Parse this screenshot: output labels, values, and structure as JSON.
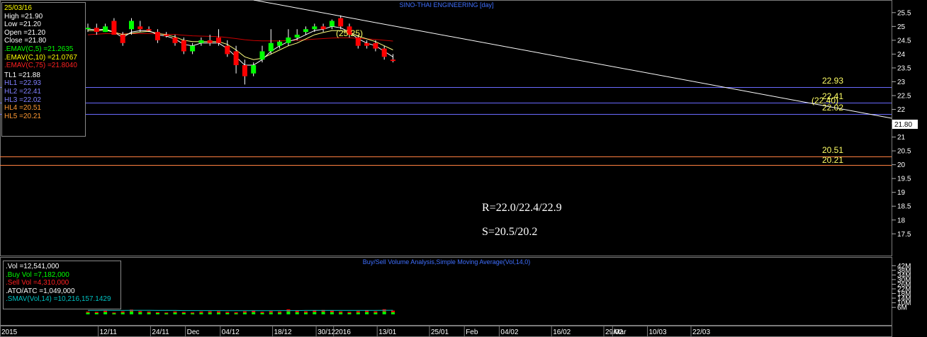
{
  "header": {
    "title": "SINO-THAI ENGINEERING [day]",
    "volume_title": "Buy/Sell Volume Analysis,Simple Moving Average(Vol,14,0)"
  },
  "info_panel": {
    "date": "25/03/16",
    "high": "High  =21.90",
    "low": "Low   =21.20",
    "open": "Open  =21.20",
    "close": "Close  =21.80",
    "emav5": ".EMAV(C,5)   =21.2635",
    "emav10": ".EMAV(C,10)  =21.0767",
    "emav75": ".EMAV(C,75)  =21.8040",
    "tl1": "TL1 =21.88",
    "hl1": "HL1 =22.93",
    "hl2": "HL2 =22.41",
    "hl3": "HL3 =22.02",
    "hl4": "HL4 =20.51",
    "hl5": "HL5 =20.21"
  },
  "volume_panel": {
    "vol": ".Vol    =12,541,000",
    "buy": ".Buy Vol   =7,182,000",
    "sell": ".Sell Vol   =4,310,000",
    "atoatc": ".ATO/ATC   =1,049,000",
    "smav": ".SMAV(Vol,14)   =10,216,157.1429"
  },
  "annotations": {
    "resistance": "R=22.0/22.4/22.9",
    "support": "S=20.5/20.2",
    "peak_label": "(25.25)",
    "high_label": "(22.40)",
    "hl1": "22.93",
    "hl2": "22.41",
    "hl3": "22.02",
    "hl4": "20.51",
    "hl5": "20.21",
    "last_price": "21.80"
  },
  "colors": {
    "up": "#00ff00",
    "down": "#ff0000",
    "ema5": "#ffffff",
    "ema10": "#ffff80",
    "ema75": "#cc0000",
    "trendline": "#ffffff",
    "resistance_lines": "#6a6aff",
    "support_lines": "#ff8040",
    "sma_volume": "#00c0c0"
  },
  "chart_data": [
    {
      "type": "candlestick",
      "title": "SINO-THAI ENGINEERING [day]",
      "ylim": [
        17.2,
        25.7
      ],
      "y_ticks": [
        17.5,
        18,
        18.5,
        19,
        19.5,
        20,
        20.5,
        21,
        21.5,
        22,
        22.5,
        23,
        23.5,
        24,
        24.5,
        25,
        25.5
      ],
      "x_ticks": [
        {
          "i": 0,
          "label": "2015"
        },
        {
          "i": 2,
          "label": "12/11"
        },
        {
          "i": 8,
          "label": "24/11"
        },
        {
          "i": 12,
          "label": "Dec"
        },
        {
          "i": 16,
          "label": "04/12"
        },
        {
          "i": 22,
          "label": "18/12"
        },
        {
          "i": 27,
          "label": "30/12"
        },
        {
          "i": 29,
          "label": "2016"
        },
        {
          "i": 34,
          "label": "13/01"
        },
        {
          "i": 40,
          "label": "25/01"
        },
        {
          "i": 44,
          "label": "Feb"
        },
        {
          "i": 48,
          "label": "04/02"
        },
        {
          "i": 54,
          "label": "16/02"
        },
        {
          "i": 60,
          "label": "29/02"
        },
        {
          "i": 61,
          "label": "Mar"
        },
        {
          "i": 65,
          "label": "10/03"
        },
        {
          "i": 70,
          "label": "22/03"
        }
      ],
      "ohlc": [
        [
          24.9,
          25.1,
          24.8,
          24.95
        ],
        [
          24.95,
          25.1,
          24.7,
          24.8
        ],
        [
          24.8,
          25.1,
          24.8,
          25.0
        ],
        [
          25.2,
          25.3,
          24.7,
          24.7
        ],
        [
          24.7,
          24.8,
          24.3,
          24.4
        ],
        [
          24.9,
          25.3,
          24.7,
          25.2
        ],
        [
          25.0,
          25.2,
          24.8,
          24.9
        ],
        [
          24.9,
          25.0,
          24.8,
          24.85
        ],
        [
          24.8,
          24.9,
          24.4,
          24.5
        ],
        [
          24.7,
          24.8,
          24.6,
          24.65
        ],
        [
          24.6,
          24.7,
          24.3,
          24.4
        ],
        [
          24.5,
          24.6,
          24.0,
          24.1
        ],
        [
          24.1,
          24.4,
          24.0,
          24.3
        ],
        [
          24.4,
          24.6,
          24.3,
          24.5
        ],
        [
          24.5,
          24.7,
          24.3,
          24.4
        ],
        [
          24.6,
          24.9,
          24.3,
          24.4
        ],
        [
          24.3,
          24.5,
          23.9,
          24.0
        ],
        [
          24.1,
          24.3,
          23.3,
          23.6
        ],
        [
          23.6,
          23.8,
          22.9,
          23.2
        ],
        [
          23.3,
          23.7,
          23.2,
          23.6
        ],
        [
          23.8,
          24.3,
          23.7,
          24.1
        ],
        [
          24.1,
          24.9,
          24.0,
          24.4
        ],
        [
          24.3,
          24.5,
          24.2,
          24.45
        ],
        [
          24.4,
          24.9,
          24.3,
          24.6
        ],
        [
          24.6,
          24.9,
          24.5,
          24.7
        ],
        [
          24.8,
          25.0,
          24.7,
          24.9
        ],
        [
          24.9,
          25.1,
          24.8,
          25.0
        ],
        [
          25.0,
          25.1,
          24.8,
          24.9
        ],
        [
          25.0,
          25.25,
          24.9,
          25.2
        ],
        [
          25.3,
          25.4,
          24.9,
          25.0
        ],
        [
          25.0,
          25.1,
          24.6,
          24.7
        ],
        [
          24.6,
          24.7,
          24.2,
          24.3
        ],
        [
          24.4,
          24.5,
          24.2,
          24.3
        ],
        [
          24.4,
          24.5,
          24.1,
          24.2
        ],
        [
          24.2,
          24.3,
          23.8,
          23.9
        ],
        [
          23.8,
          24.0,
          23.7,
          23.75
        ]
      ],
      "ema5": [
        24.9,
        24.88,
        24.9,
        24.8,
        24.6,
        24.8,
        24.85,
        24.85,
        24.7,
        24.65,
        24.55,
        24.35,
        24.3,
        24.4,
        24.4,
        24.4,
        24.2,
        23.9,
        23.6,
        23.6,
        23.8,
        24.1,
        24.3,
        24.45,
        24.55,
        24.7,
        24.85,
        24.9,
        25.0,
        24.95,
        24.8,
        24.55,
        24.4,
        24.3,
        24.1,
        23.9
      ],
      "ema10": [
        24.85,
        24.85,
        24.86,
        24.8,
        24.7,
        24.75,
        24.8,
        24.82,
        24.75,
        24.7,
        24.62,
        24.5,
        24.45,
        24.45,
        24.45,
        24.45,
        24.35,
        24.15,
        23.9,
        23.8,
        23.85,
        24.0,
        24.15,
        24.3,
        24.4,
        24.55,
        24.7,
        24.78,
        24.85,
        24.85,
        24.8,
        24.65,
        24.55,
        24.45,
        24.3,
        24.15
      ],
      "ema75": [
        24.7,
        24.72,
        24.74,
        24.74,
        24.73,
        24.74,
        24.74,
        24.74,
        24.73,
        24.72,
        24.71,
        24.68,
        24.66,
        24.65,
        24.64,
        24.63,
        24.6,
        24.56,
        24.52,
        24.49,
        24.48,
        24.48,
        24.48,
        24.49,
        24.5,
        24.52,
        24.54,
        24.56,
        24.58,
        24.59,
        24.59,
        24.57,
        24.55,
        24.53,
        24.5,
        24.47
      ]
    },
    {
      "type": "bar",
      "title": "Buy/Sell Volume Analysis,Simple Moving Average(Vol,14,0)",
      "y_ticks": [
        6,
        10,
        14,
        18,
        22,
        26,
        30,
        34,
        38,
        42
      ],
      "y_unit": "M",
      "ylim": [
        0,
        44
      ],
      "buy_vol_m": [
        1.5,
        1.2,
        2.0,
        1.0,
        1.5,
        2.5,
        1.8,
        1.5,
        1.2,
        1.0,
        1.5,
        1.2,
        1.0,
        1.4,
        1.6,
        1.5,
        1.2,
        1.0,
        1.5,
        1.8,
        1.2,
        1.6,
        1.5,
        2.5,
        1.8,
        1.5,
        2.0,
        2.2,
        1.8,
        1.5,
        1.2,
        1.6,
        2.0,
        1.5,
        2.5,
        1.8
      ],
      "sell_vol_m": [
        0.8,
        0.9,
        1.2,
        0.6,
        1.0,
        1.6,
        1.0,
        0.9,
        0.7,
        0.6,
        0.9,
        0.8,
        0.7,
        1.0,
        1.1,
        1.2,
        0.9,
        0.8,
        1.1,
        1.3,
        0.9,
        1.2,
        1.0,
        1.8,
        1.2,
        1.1,
        1.4,
        1.6,
        1.3,
        1.0,
        0.9,
        1.2,
        1.4,
        1.1,
        1.9,
        1.4
      ],
      "sma_vol_m": [
        3.4,
        3.4,
        3.5,
        3.4,
        3.4,
        3.5,
        3.5,
        3.5,
        3.4,
        3.4,
        3.4,
        3.3,
        3.3,
        3.3,
        3.3,
        3.3,
        3.2,
        3.2,
        3.2,
        3.2,
        3.2,
        3.2,
        3.3,
        3.3,
        3.3,
        3.4,
        3.4,
        3.4,
        3.4,
        3.4,
        3.4,
        3.4,
        3.4,
        3.4,
        3.5,
        3.5
      ]
    }
  ]
}
